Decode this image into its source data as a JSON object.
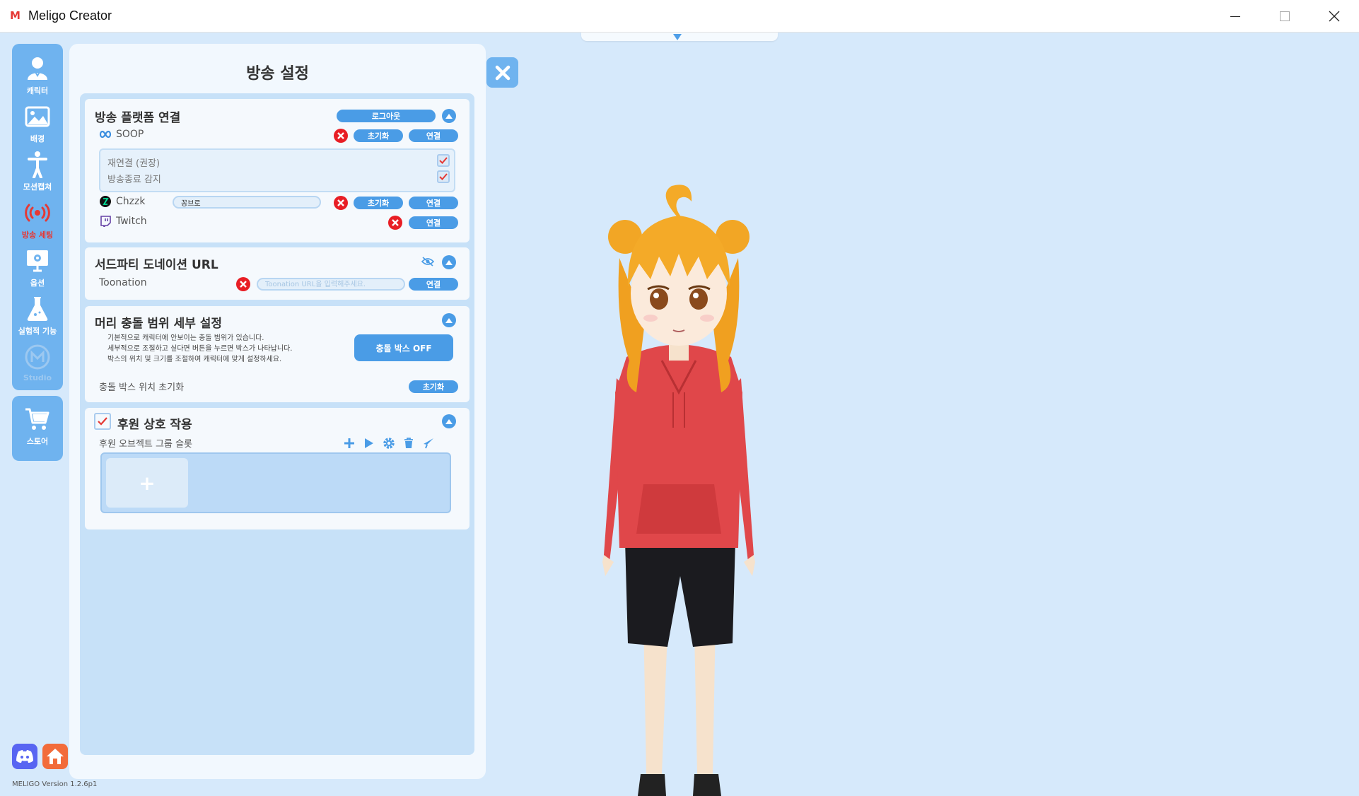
{
  "window": {
    "logo_letter": "M",
    "title": "Meligo Creator"
  },
  "sidebar": {
    "items": [
      {
        "label": "캐릭터",
        "icon": "character-icon",
        "state": "normal"
      },
      {
        "label": "배경",
        "icon": "background-image-icon",
        "state": "normal"
      },
      {
        "label": "모션캡쳐",
        "icon": "motion-capture-icon",
        "state": "normal"
      },
      {
        "label": "방송 세팅",
        "icon": "broadcast-icon",
        "state": "active"
      },
      {
        "label": "옵션",
        "icon": "monitor-settings-icon",
        "state": "normal"
      },
      {
        "label": "실험적 기능",
        "icon": "flask-icon",
        "state": "normal"
      },
      {
        "label": "Studio",
        "icon": "studio-logo-icon",
        "state": "disabled"
      }
    ],
    "store_label": "스토어"
  },
  "footer": {
    "version": "MELIGO Version 1.2.6p1"
  },
  "panel": {
    "title": "방송 설정",
    "platform": {
      "title": "방송 플랫폼 연결",
      "logout_label": "로그아웃",
      "soop": {
        "name": "SOOP",
        "reset_label": "초기화",
        "connect_label": "연결"
      },
      "options": [
        {
          "label": "재연결 (권장)",
          "checked": true
        },
        {
          "label": "방송종료 감지",
          "checked": true
        }
      ],
      "chzzk": {
        "name": "Chzzk",
        "input_value": "꽁브로",
        "reset_label": "초기화",
        "connect_label": "연결"
      },
      "twitch": {
        "name": "Twitch",
        "connect_label": "연결"
      }
    },
    "donation": {
      "title": "서드파티 도네이션 URL",
      "toonation": {
        "name": "Toonation",
        "placeholder": "Toonation URL을 입력해주세요.",
        "connect_label": "연결"
      }
    },
    "collision": {
      "title": "머리 충돌 범위 세부 설정",
      "desc_lines": [
        "기본적으로 캐릭터에 안보이는 충돌 범위가 있습니다.",
        "세부적으로 조절하고 싶다면 버튼을 누르면 박스가 나타납니다.",
        "박스의 위치 및 크기를 조절하여 캐릭터에 맞게 설정하세요."
      ],
      "toggle_label": "충돌 박스 OFF",
      "reset_row_label": "충돌 박스 위치  초기화",
      "reset_label": "초기화"
    },
    "sponsor": {
      "title": "후원 상호 작용",
      "checked": true,
      "group_label": "후원 오브젝트 그룹 슬롯",
      "add_slot_glyph": "+"
    }
  },
  "colors": {
    "accent": "#4a9ce6",
    "sidebar": "#6fb3ef",
    "background": "#d6e9fb",
    "danger": "#e81e25",
    "active_label": "#e53935"
  }
}
